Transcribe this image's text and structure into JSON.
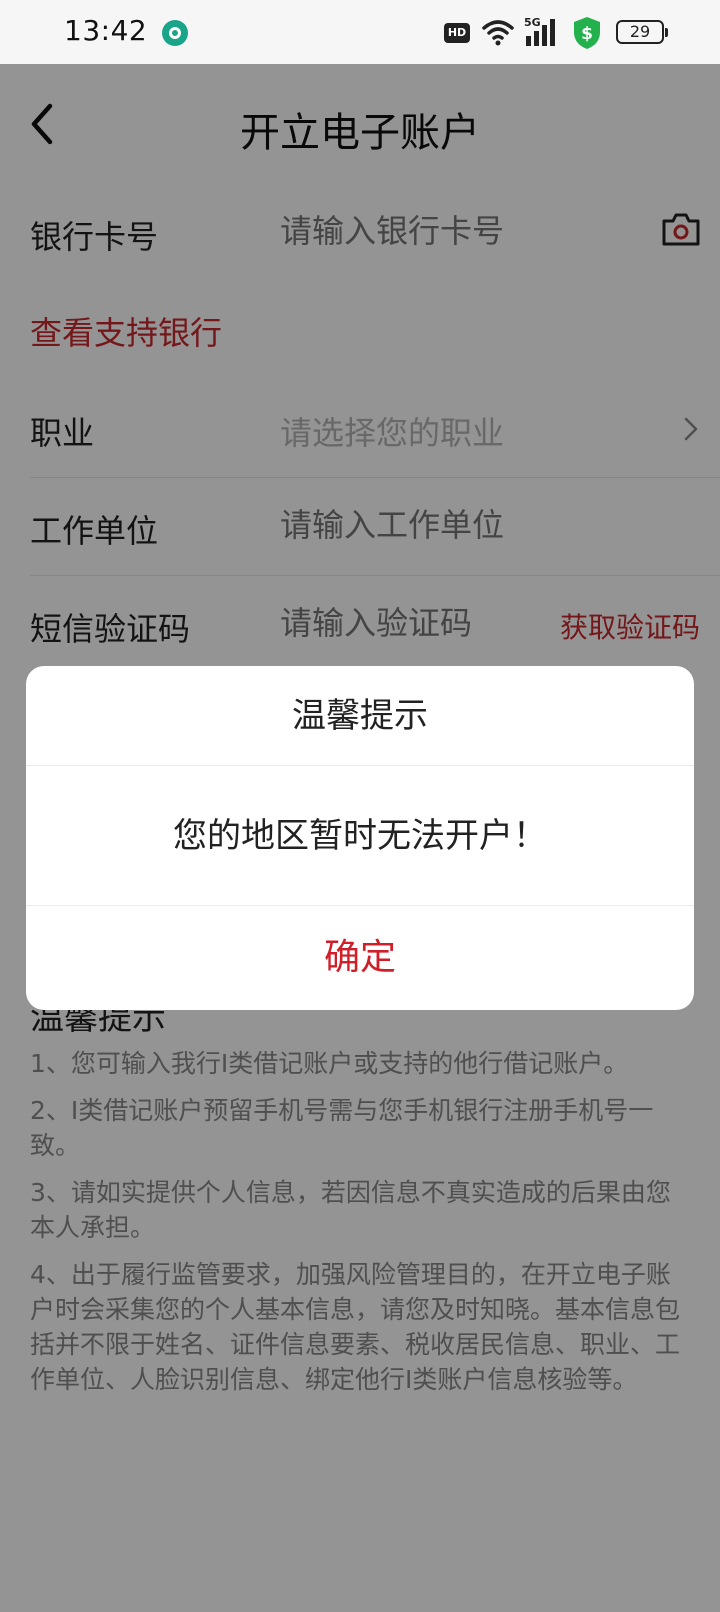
{
  "status_bar": {
    "time": "13:42",
    "hd_label": "HD",
    "network_label": "5G",
    "battery": "29",
    "icons": [
      "app-icon",
      "wifi-icon",
      "signal-icon",
      "security-shield-icon",
      "battery-icon"
    ]
  },
  "header": {
    "title": "开立电子账户",
    "back_icon": "chevron-left-icon"
  },
  "form": {
    "bank_card": {
      "label": "银行卡号",
      "placeholder": "请输入银行卡号",
      "icon": "camera-icon"
    },
    "support_link": "查看支持银行",
    "occupation": {
      "label": "职业",
      "placeholder": "请选择您的职业",
      "icon": "chevron-right-icon"
    },
    "employer": {
      "label": "工作单位",
      "placeholder": "请输入工作单位"
    },
    "sms_code": {
      "label": "短信验证码",
      "placeholder": "请输入验证码",
      "button": "获取验证码"
    }
  },
  "tips": {
    "title": "温馨提示",
    "items": [
      "1、您可输入我行I类借记账户或支持的他行借记账户。",
      "2、I类借记账户预留手机号需与您手机银行注册手机号一致。",
      "3、请如实提供个人信息，若因信息不真实造成的后果由您本人承担。",
      "4、出于履行监管要求，加强风险管理目的，在开立电子账户时会采集您的个人基本信息，请您及时知晓。基本信息包括并不限于姓名、证件信息要素、税收居民信息、职业、工作单位、人脸识别信息、绑定他行I类账户信息核验等。"
    ]
  },
  "dialog": {
    "title": "温馨提示",
    "message": "您的地区暂时无法开户！",
    "confirm": "确定"
  },
  "colors": {
    "accent_red": "#c8282d",
    "dialog_button_red": "#d11f2a",
    "placeholder_gray": "#b4b4b4",
    "overlay": "rgba(0,0,0,0.42)"
  }
}
